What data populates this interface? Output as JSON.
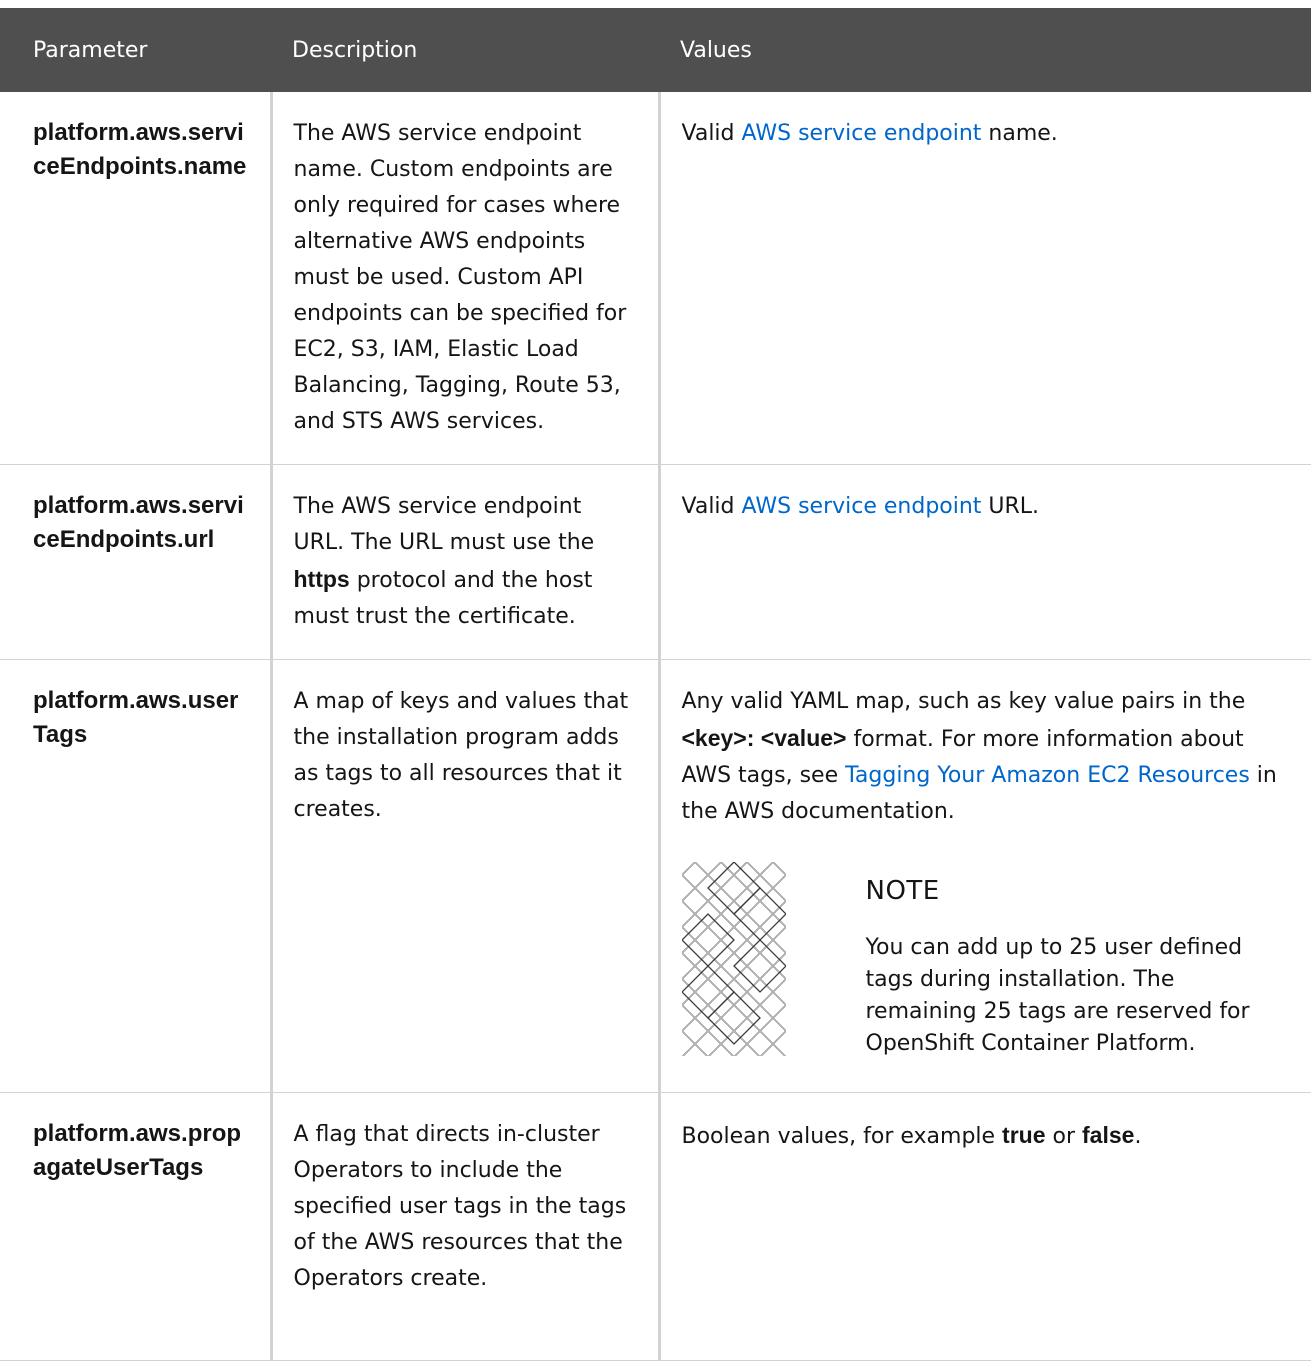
{
  "header": {
    "col_parameter": "Parameter",
    "col_description": "Description",
    "col_values": "Values"
  },
  "rows": [
    {
      "parameter": "platform.aws.serviceEndpoints.name",
      "description": "The AWS service endpoint name. Custom endpoints are only required for cases where alternative AWS endpoints must be used. Custom API endpoints can be specified for EC2, S3, IAM, Elastic Load Balancing, Tagging, Route 53, and STS AWS services.",
      "value_prefix": "Valid ",
      "value_link": "AWS service endpoint",
      "value_suffix": " name."
    },
    {
      "parameter": "platform.aws.serviceEndpoints.url",
      "description_pre": "The AWS service endpoint URL. The URL must use the ",
      "description_bold": "https",
      "description_post": " protocol and the host must trust the certificate.",
      "value_prefix": "Valid ",
      "value_link": "AWS service endpoint",
      "value_suffix": " URL."
    },
    {
      "parameter": "platform.aws.userTags",
      "description": "A map of keys and values that the installation program adds as tags to all resources that it creates.",
      "value_pre": "Any valid YAML map, such as key value pairs in the ",
      "value_bold": "<key>: <value>",
      "value_mid": " format. For more information about AWS tags, see ",
      "value_link": "Tagging Your Amazon EC2 Resources",
      "value_post": " in the AWS documentation.",
      "note": {
        "title": "NOTE",
        "text": "You can add up to 25 user defined tags during installation. The remaining 25 tags are reserved for OpenShift Container Platform.",
        "icon": "note-pattern-icon"
      }
    },
    {
      "parameter": "platform.aws.propagateUserTags",
      "description": "A flag that directs in-cluster Operators to include the specified user tags in the tags of the AWS resources that the Operators create.",
      "value_pre": "Boolean values, for example ",
      "value_bold1": "true",
      "value_mid": " or ",
      "value_bold2": "false",
      "value_post": "."
    }
  ],
  "colors": {
    "header_bg": "#4f4f4f",
    "link": "#0066cc",
    "border": "#d2d2d2"
  }
}
